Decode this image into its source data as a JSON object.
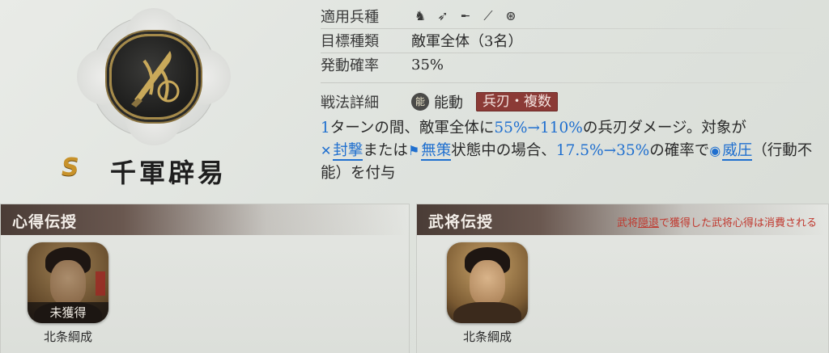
{
  "skill": {
    "rank": "S",
    "name": "千軍辟易",
    "icon": "sword-emblem-icon"
  },
  "info": {
    "unit_types_label": "適用兵種",
    "unit_type_icons": [
      "cavalry-icon",
      "bow-icon",
      "gun-icon",
      "spear-icon",
      "wheel-icon"
    ],
    "target_label": "目標種類",
    "target_value": "敵軍全体（3名）",
    "rate_label": "発動確率",
    "rate_value": "35%",
    "detail_label": "戦法詳細",
    "detail_badge": "能",
    "detail_kind": "能動",
    "detail_tag": "兵刃・複数"
  },
  "description": {
    "p1": "1",
    "p2": "ターンの間、敵軍全体に",
    "p3": "55%→110%",
    "p4": "の兵刃ダメージ。対象が",
    "kw1": "封撃",
    "p5": "または",
    "kw2": "無策",
    "p6": "状態中の場合、",
    "p7": "17.5%→35%",
    "p8": "の確率で",
    "kw3": "威圧",
    "p9": "（行動不能）を付与"
  },
  "panels": {
    "left_title": "心得伝授",
    "right_title": "武将伝授",
    "right_note_a": "武将",
    "right_note_link": "隠退",
    "right_note_b": "で獲得した武将心得は消費される",
    "left_status": "未獲得",
    "left_name": "北条綱成",
    "right_name": "北条綱成"
  },
  "colors": {
    "accent_blue": "#1f6fcf",
    "tag_red": "#8b3a36",
    "rank_gold": "#c8922a",
    "note_red": "#c0382e"
  }
}
